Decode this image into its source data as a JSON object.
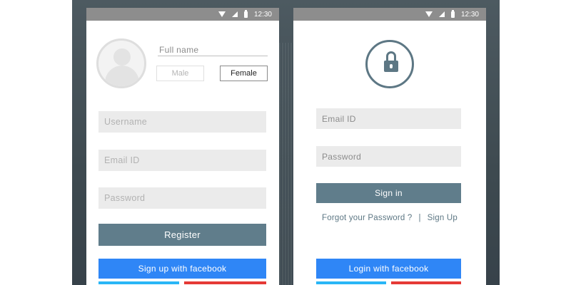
{
  "status_bar": {
    "time": "12:30",
    "icons": [
      "wifi-icon",
      "signal-icon",
      "battery-icon"
    ]
  },
  "register_screen": {
    "avatar_icon": "user-avatar-icon",
    "full_name_placeholder": "Full name",
    "gender": {
      "male_label": "Male",
      "female_label": "Female",
      "selected": "Female"
    },
    "username_placeholder": "Username",
    "email_placeholder": "Email ID",
    "password_placeholder": "Password",
    "register_label": "Register",
    "facebook_label": "Sign up with facebook"
  },
  "login_screen": {
    "lock_icon": "lock-icon",
    "email_placeholder": "Email ID",
    "password_placeholder": "Password",
    "signin_label": "Sign in",
    "forgot_label": "Forgot your Password ?",
    "separator": "|",
    "signup_label": "Sign Up",
    "facebook_label": "Login with facebook"
  },
  "colors": {
    "primary_button": "#607d8b",
    "facebook_button": "#2f86f6",
    "twitter_strip": "#29b6f6",
    "google_strip": "#e53935",
    "input_background": "#ebebeb",
    "status_bar": "#8d8d8d"
  }
}
